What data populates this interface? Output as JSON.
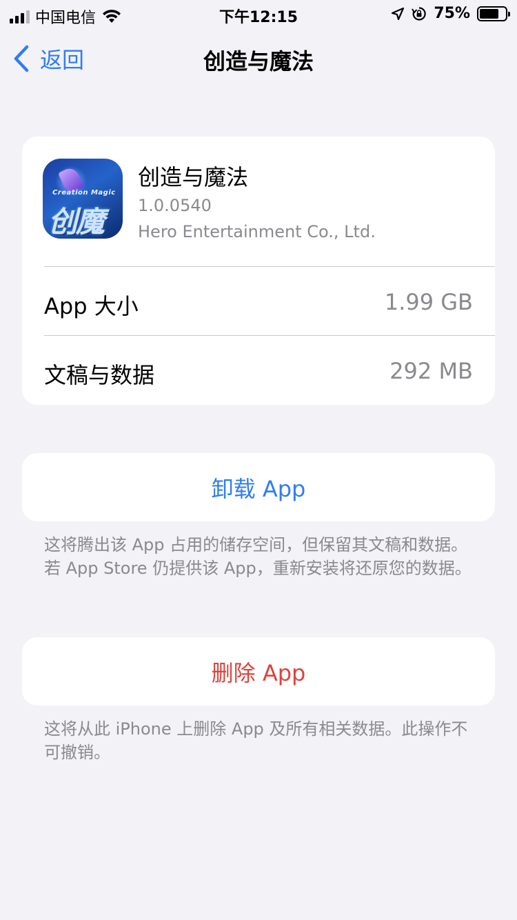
{
  "status_bar": {
    "carrier": "中国电信",
    "time": "下午12:15",
    "battery": "75%",
    "battery_level": 0.75
  },
  "nav": {
    "back_label": "返回",
    "title": "创造与魔法"
  },
  "app": {
    "icon_text_small": "Creation Magic",
    "icon_text_logo": "创魔",
    "name": "创造与魔法",
    "version": "1.0.0540",
    "developer": "Hero Entertainment Co., Ltd."
  },
  "storage": {
    "app_size_label": "App 大小",
    "app_size_value": "1.99 GB",
    "docs_label": "文稿与数据",
    "docs_value": "292 MB"
  },
  "offload": {
    "label": "卸载 App",
    "note": "这将腾出该 App 占用的储存空间，但保留其文稿和数据。若 App Store 仍提供该 App，重新安装将还原您的数据。"
  },
  "delete": {
    "label": "删除 App",
    "note": "这将从此 iPhone 上删除 App 及所有相关数据。此操作不可撤销。"
  },
  "colors": {
    "accent_blue": "#2f7cf6",
    "destructive_red": "#e0413b",
    "background": "#f2f2f7",
    "secondary_text": "#8a8a8e"
  }
}
